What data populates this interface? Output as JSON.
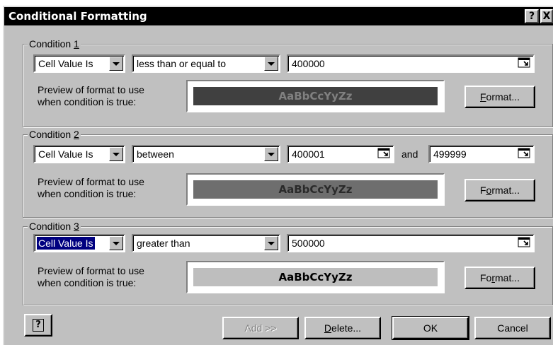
{
  "window": {
    "title": "Conditional Formatting",
    "help_glyph": "?",
    "close_glyph": "X"
  },
  "conditions": [
    {
      "legend_prefix": "Condition ",
      "legend_number": "1",
      "type_value": "Cell Value Is",
      "operator_value": "less than or equal to",
      "value1": "400000",
      "preview_label_line1": "Preview of format to use",
      "preview_label_line2": "when condition is true:",
      "preview_text": "AaBbCcYyZz",
      "preview_color": "#404040",
      "format_prefix": "",
      "format_ul": "F",
      "format_suffix": "ormat..."
    },
    {
      "legend_prefix": "Condition ",
      "legend_number": "2",
      "type_value": "Cell Value Is",
      "operator_value": "between",
      "value1": "400001",
      "and_label": "and",
      "value2": "499999",
      "preview_label_line1": "Preview of format to use",
      "preview_label_line2": "when condition is true:",
      "preview_text": "AaBbCcYyZz",
      "preview_color": "#6e6e6e",
      "format_prefix": "F",
      "format_ul": "o",
      "format_suffix": "rmat..."
    },
    {
      "legend_prefix": "Condition ",
      "legend_number": "3",
      "type_value": "Cell Value Is",
      "operator_value": "greater than",
      "value1": "500000",
      "preview_label_line1": "Preview of format to use",
      "preview_label_line2": "when condition is true:",
      "preview_text": "AaBbCcYyZz",
      "preview_color": "#bebebe",
      "format_prefix": "Fo",
      "format_ul": "r",
      "format_suffix": "mat..."
    }
  ],
  "buttons": {
    "help_glyph": "?",
    "add_label": "Add >>",
    "delete_ul": "D",
    "delete_suffix": "elete...",
    "ok_label": "OK",
    "cancel_label": "Cancel"
  }
}
